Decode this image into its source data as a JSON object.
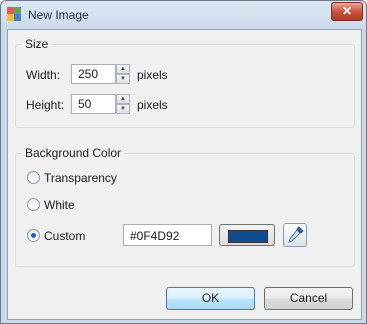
{
  "window": {
    "title": "New Image",
    "close_glyph": "✕"
  },
  "size_group": {
    "title": "Size",
    "width": {
      "label": "Width:",
      "value": "250",
      "unit": "pixels"
    },
    "height": {
      "label": "Height:",
      "value": "50",
      "unit": "pixels"
    }
  },
  "background_group": {
    "title": "Background Color",
    "options": [
      {
        "label": "Transparency",
        "checked": false
      },
      {
        "label": "White",
        "checked": false
      },
      {
        "label": "Custom",
        "checked": true
      }
    ],
    "custom_hex": "#0F4D92",
    "swatch_color": "#0f4d92",
    "picker_icon": "eyedropper-icon"
  },
  "buttons": {
    "ok": "OK",
    "cancel": "Cancel"
  },
  "colors": {
    "title_bar": "#c9d8ea",
    "close_button": "#c9553f",
    "app_icon": [
      "#e05a5a",
      "#5aa84b",
      "#f0c030",
      "#4a7fd0"
    ]
  }
}
